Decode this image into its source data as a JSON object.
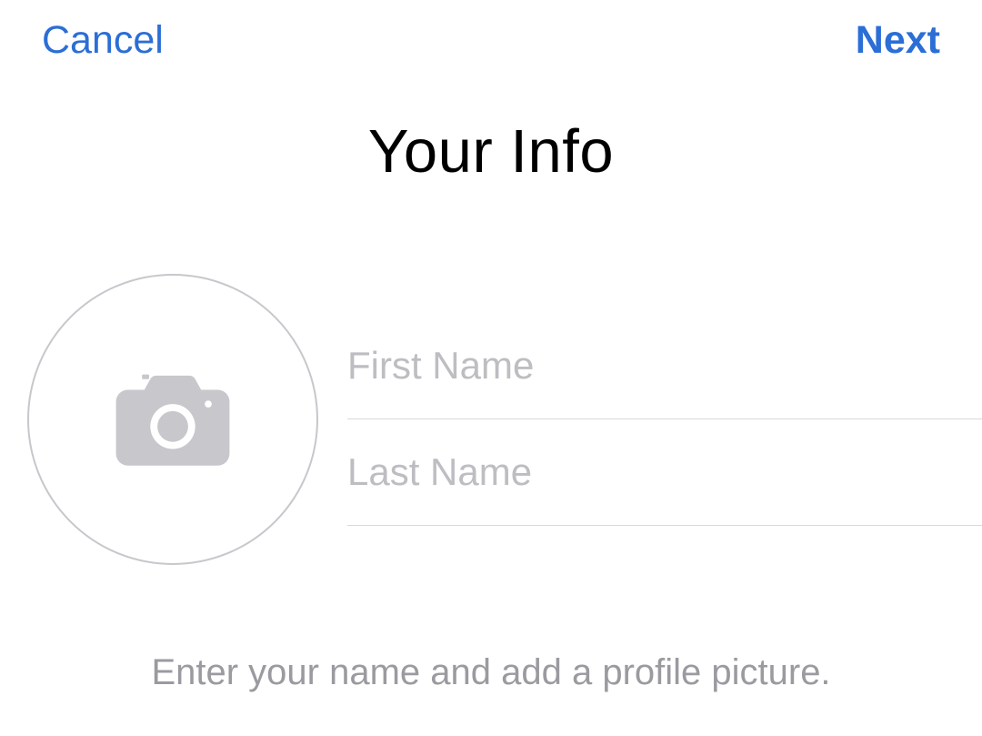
{
  "nav": {
    "cancel_label": "Cancel",
    "next_label": "Next"
  },
  "title": "Your Info",
  "form": {
    "first_name_placeholder": "First Name",
    "first_name_value": "",
    "last_name_placeholder": "Last Name",
    "last_name_value": ""
  },
  "hint_text": "Enter your name and add a profile picture."
}
